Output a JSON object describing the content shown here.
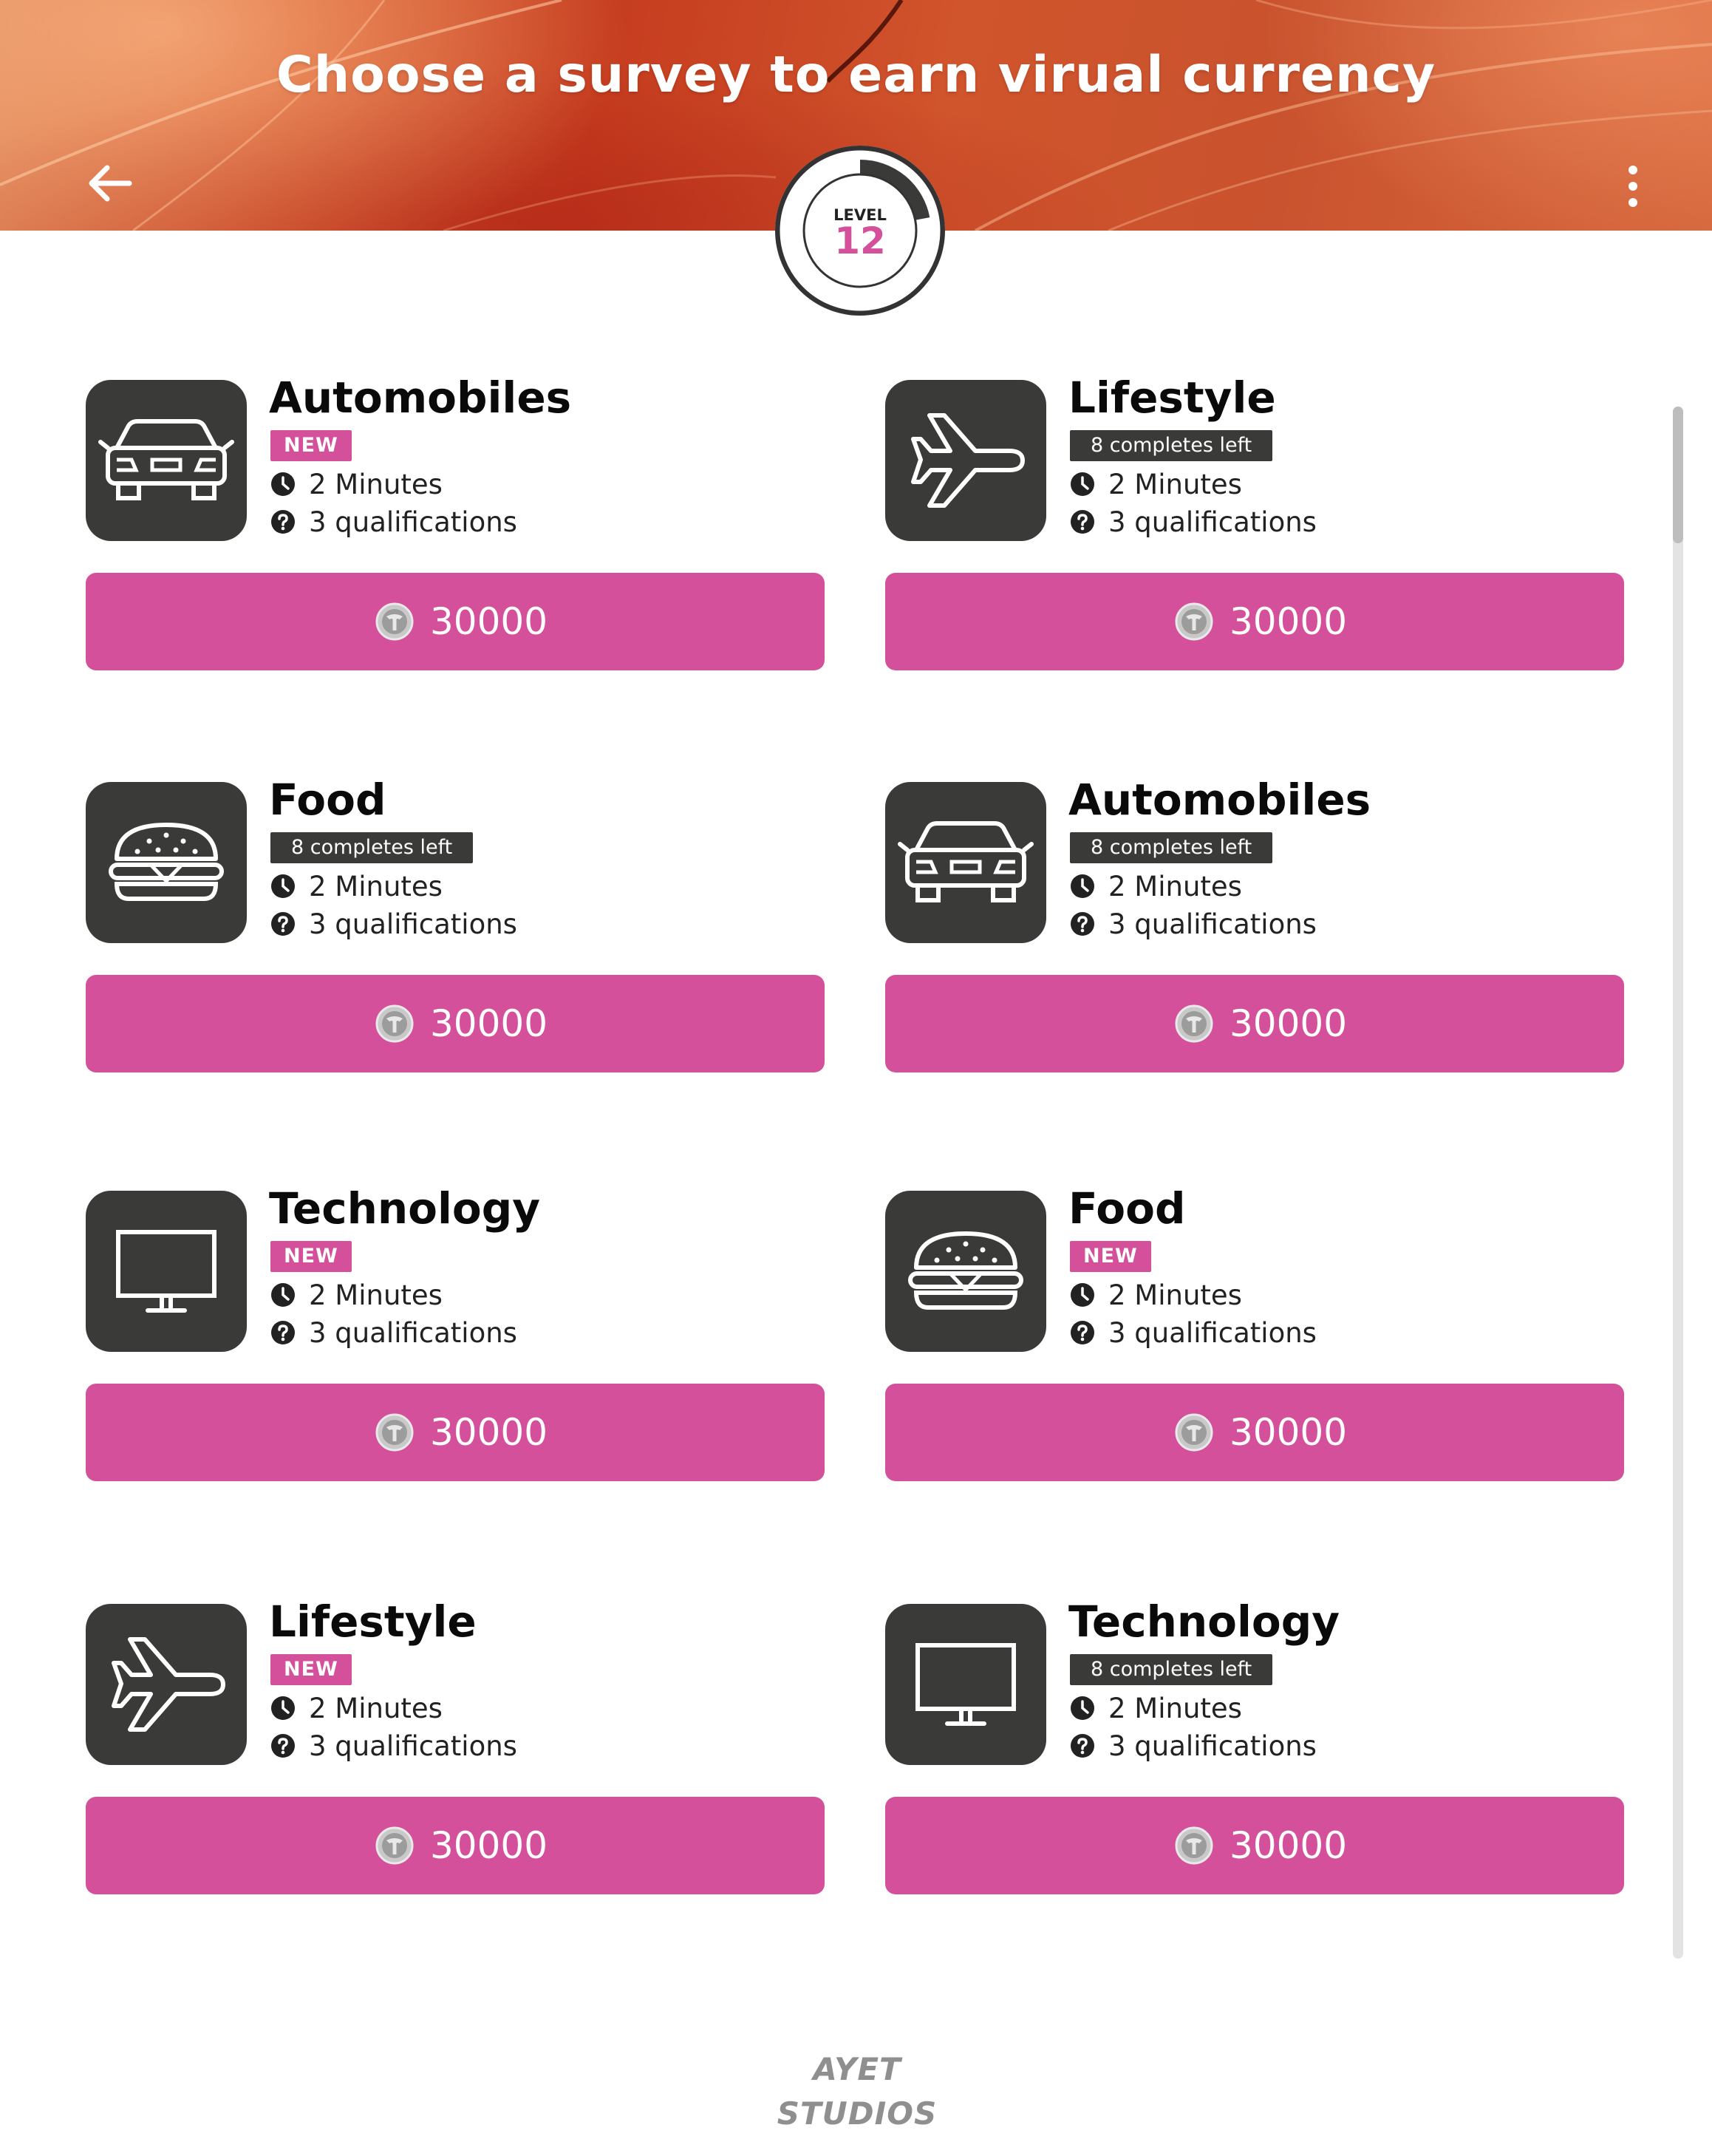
{
  "header": {
    "title": "Choose a survey to earn virual currency",
    "back_icon": "arrow-left-icon",
    "menu_icon": "more-vertical-icon"
  },
  "level": {
    "label": "LEVEL",
    "value": "12",
    "progress": 0.22
  },
  "colors": {
    "accent": "#d5509a",
    "tile": "#3a3a39",
    "header_orange": "#c63d1f"
  },
  "surveys": [
    {
      "title": "Automobiles",
      "icon": "car-icon",
      "tag": "NEW",
      "tag_type": "new",
      "time": "2 Minutes",
      "qualifications": "3 qualifications",
      "reward": "30000"
    },
    {
      "title": "Lifestyle",
      "icon": "airplane-icon",
      "tag": "8 completes left",
      "tag_type": "left",
      "time": "2 Minutes",
      "qualifications": "3 qualifications",
      "reward": "30000"
    },
    {
      "title": "Food",
      "icon": "burger-icon",
      "tag": "8 completes left",
      "tag_type": "left",
      "time": "2 Minutes",
      "qualifications": "3 qualifications",
      "reward": "30000"
    },
    {
      "title": "Automobiles",
      "icon": "car-icon",
      "tag": "8 completes left",
      "tag_type": "left",
      "time": "2 Minutes",
      "qualifications": "3 qualifications",
      "reward": "30000"
    },
    {
      "title": "Technology",
      "icon": "monitor-icon",
      "tag": "NEW",
      "tag_type": "new",
      "time": "2 Minutes",
      "qualifications": "3 qualifications",
      "reward": "30000"
    },
    {
      "title": "Food",
      "icon": "burger-icon",
      "tag": "NEW",
      "tag_type": "new",
      "time": "2 Minutes",
      "qualifications": "3 qualifications",
      "reward": "30000"
    },
    {
      "title": "Lifestyle",
      "icon": "airplane-icon",
      "tag": "NEW",
      "tag_type": "new",
      "time": "2 Minutes",
      "qualifications": "3 qualifications",
      "reward": "30000"
    },
    {
      "title": "Technology",
      "icon": "monitor-icon",
      "tag": "8 completes left",
      "tag_type": "left",
      "time": "2 Minutes",
      "qualifications": "3 qualifications",
      "reward": "30000"
    }
  ],
  "footer": {
    "logo_text": "AYET STUDIOS"
  }
}
